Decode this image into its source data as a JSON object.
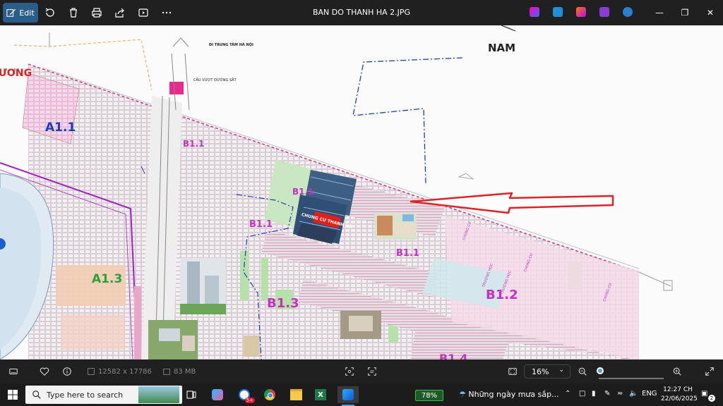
{
  "toolbar": {
    "edit_label": "Edit",
    "title": "BAN DO THANH HA 2.JPG"
  },
  "map": {
    "labels": {
      "a11": "A1.1",
      "a13": "A1.3",
      "b11_a": "B1.1",
      "b11_b": "B1.1",
      "b11_c": "B1.1",
      "b11_d": "B1.1",
      "b12": "B1.2",
      "b13": "B1.3",
      "b14": "B1.4",
      "nam": "NAM",
      "vong": "ƯƠNG",
      "di_trung_tam": "ĐI TRUNG TÂM HÀ NỘI",
      "cau_vuot": "CẦU VƯỢT ĐƯỜNG SẮT",
      "red_sign": "CHUNG CƯ THANH HÀ",
      "truong_hoc_1": "TRƯỜNG HỌC",
      "truong_hoc_2": "TRƯỜNG HỌC",
      "chung_cu_1": "CHUNG CƯ",
      "chung_cu_2": "CHUNG CƯ",
      "chung_cu_3": "CHUNG CƯ"
    }
  },
  "status": {
    "dimensions": "12582 x 17786",
    "size": "83 MB",
    "zoom": "16%",
    "zoom_fraction": 0.16
  },
  "taskbar": {
    "search_placeholder": "Type here to search",
    "battery": "78%",
    "weather": "Những ngày mưa sắp...",
    "lang": "ENG",
    "time": "12:27 CH",
    "date": "22/06/2025",
    "notif_badge": "2",
    "chrome_badge": "5+"
  }
}
